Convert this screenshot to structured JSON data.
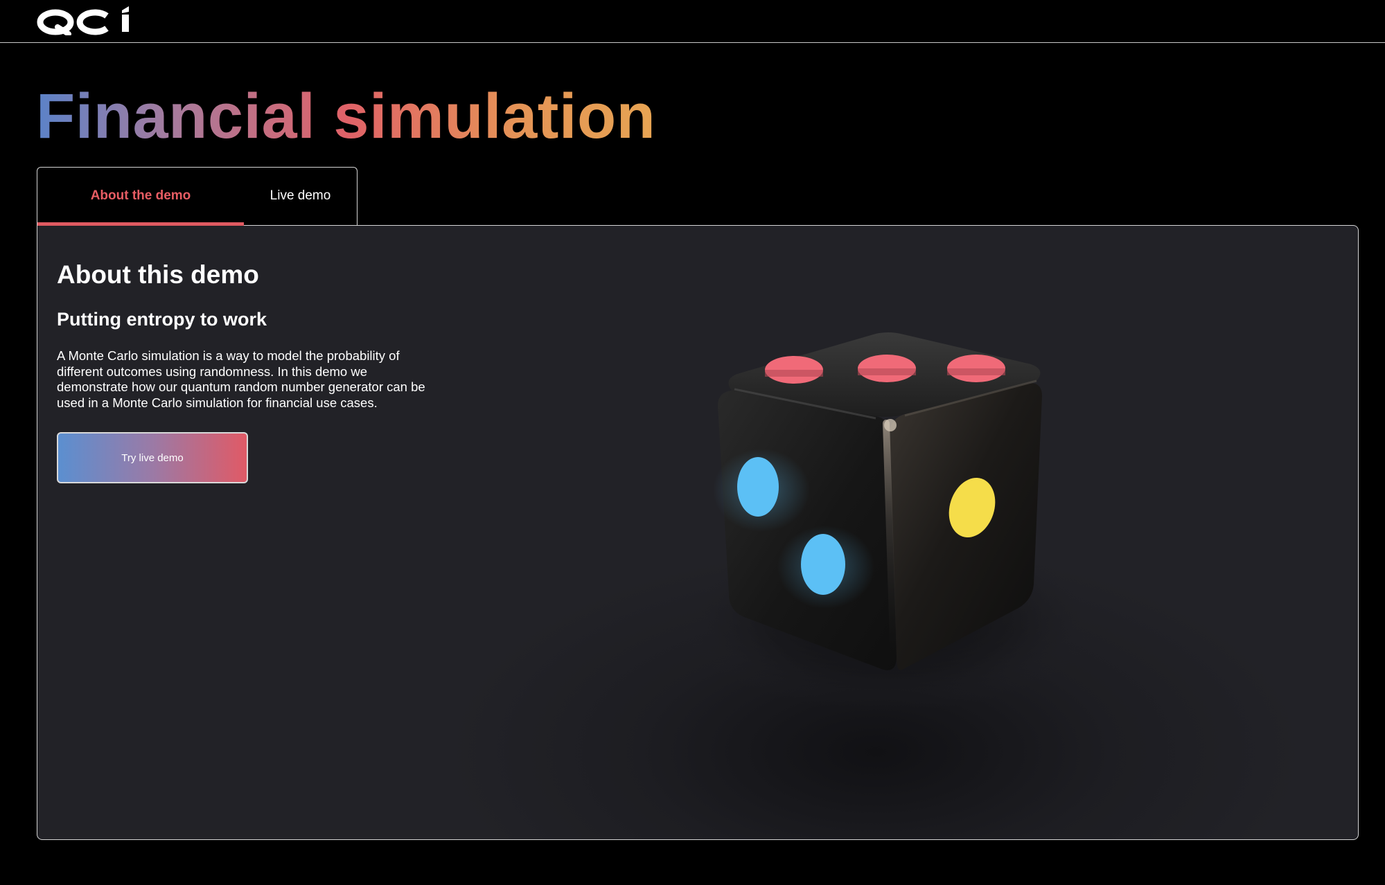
{
  "header": {
    "logo_text": "QCi"
  },
  "page": {
    "title": "Financial simulation"
  },
  "tabs": [
    {
      "label": "About the demo",
      "active": true
    },
    {
      "label": "Live demo",
      "active": false
    }
  ],
  "panel": {
    "heading": "About this demo",
    "subheading": "Putting entropy to work",
    "description": "A Monte Carlo simulation is a way to model the probability of different outcomes using randomness. In this demo we demonstrate how our quantum random number generator can be used in a Monte Carlo simulation for financial use cases.",
    "cta_label": "Try live demo"
  },
  "colors": {
    "accent_red": "#e05a61",
    "pip_red": "#f06a78",
    "pip_blue": "#5cc0f5",
    "pip_yellow": "#f5dd4a",
    "panel_bg": "#222227"
  }
}
